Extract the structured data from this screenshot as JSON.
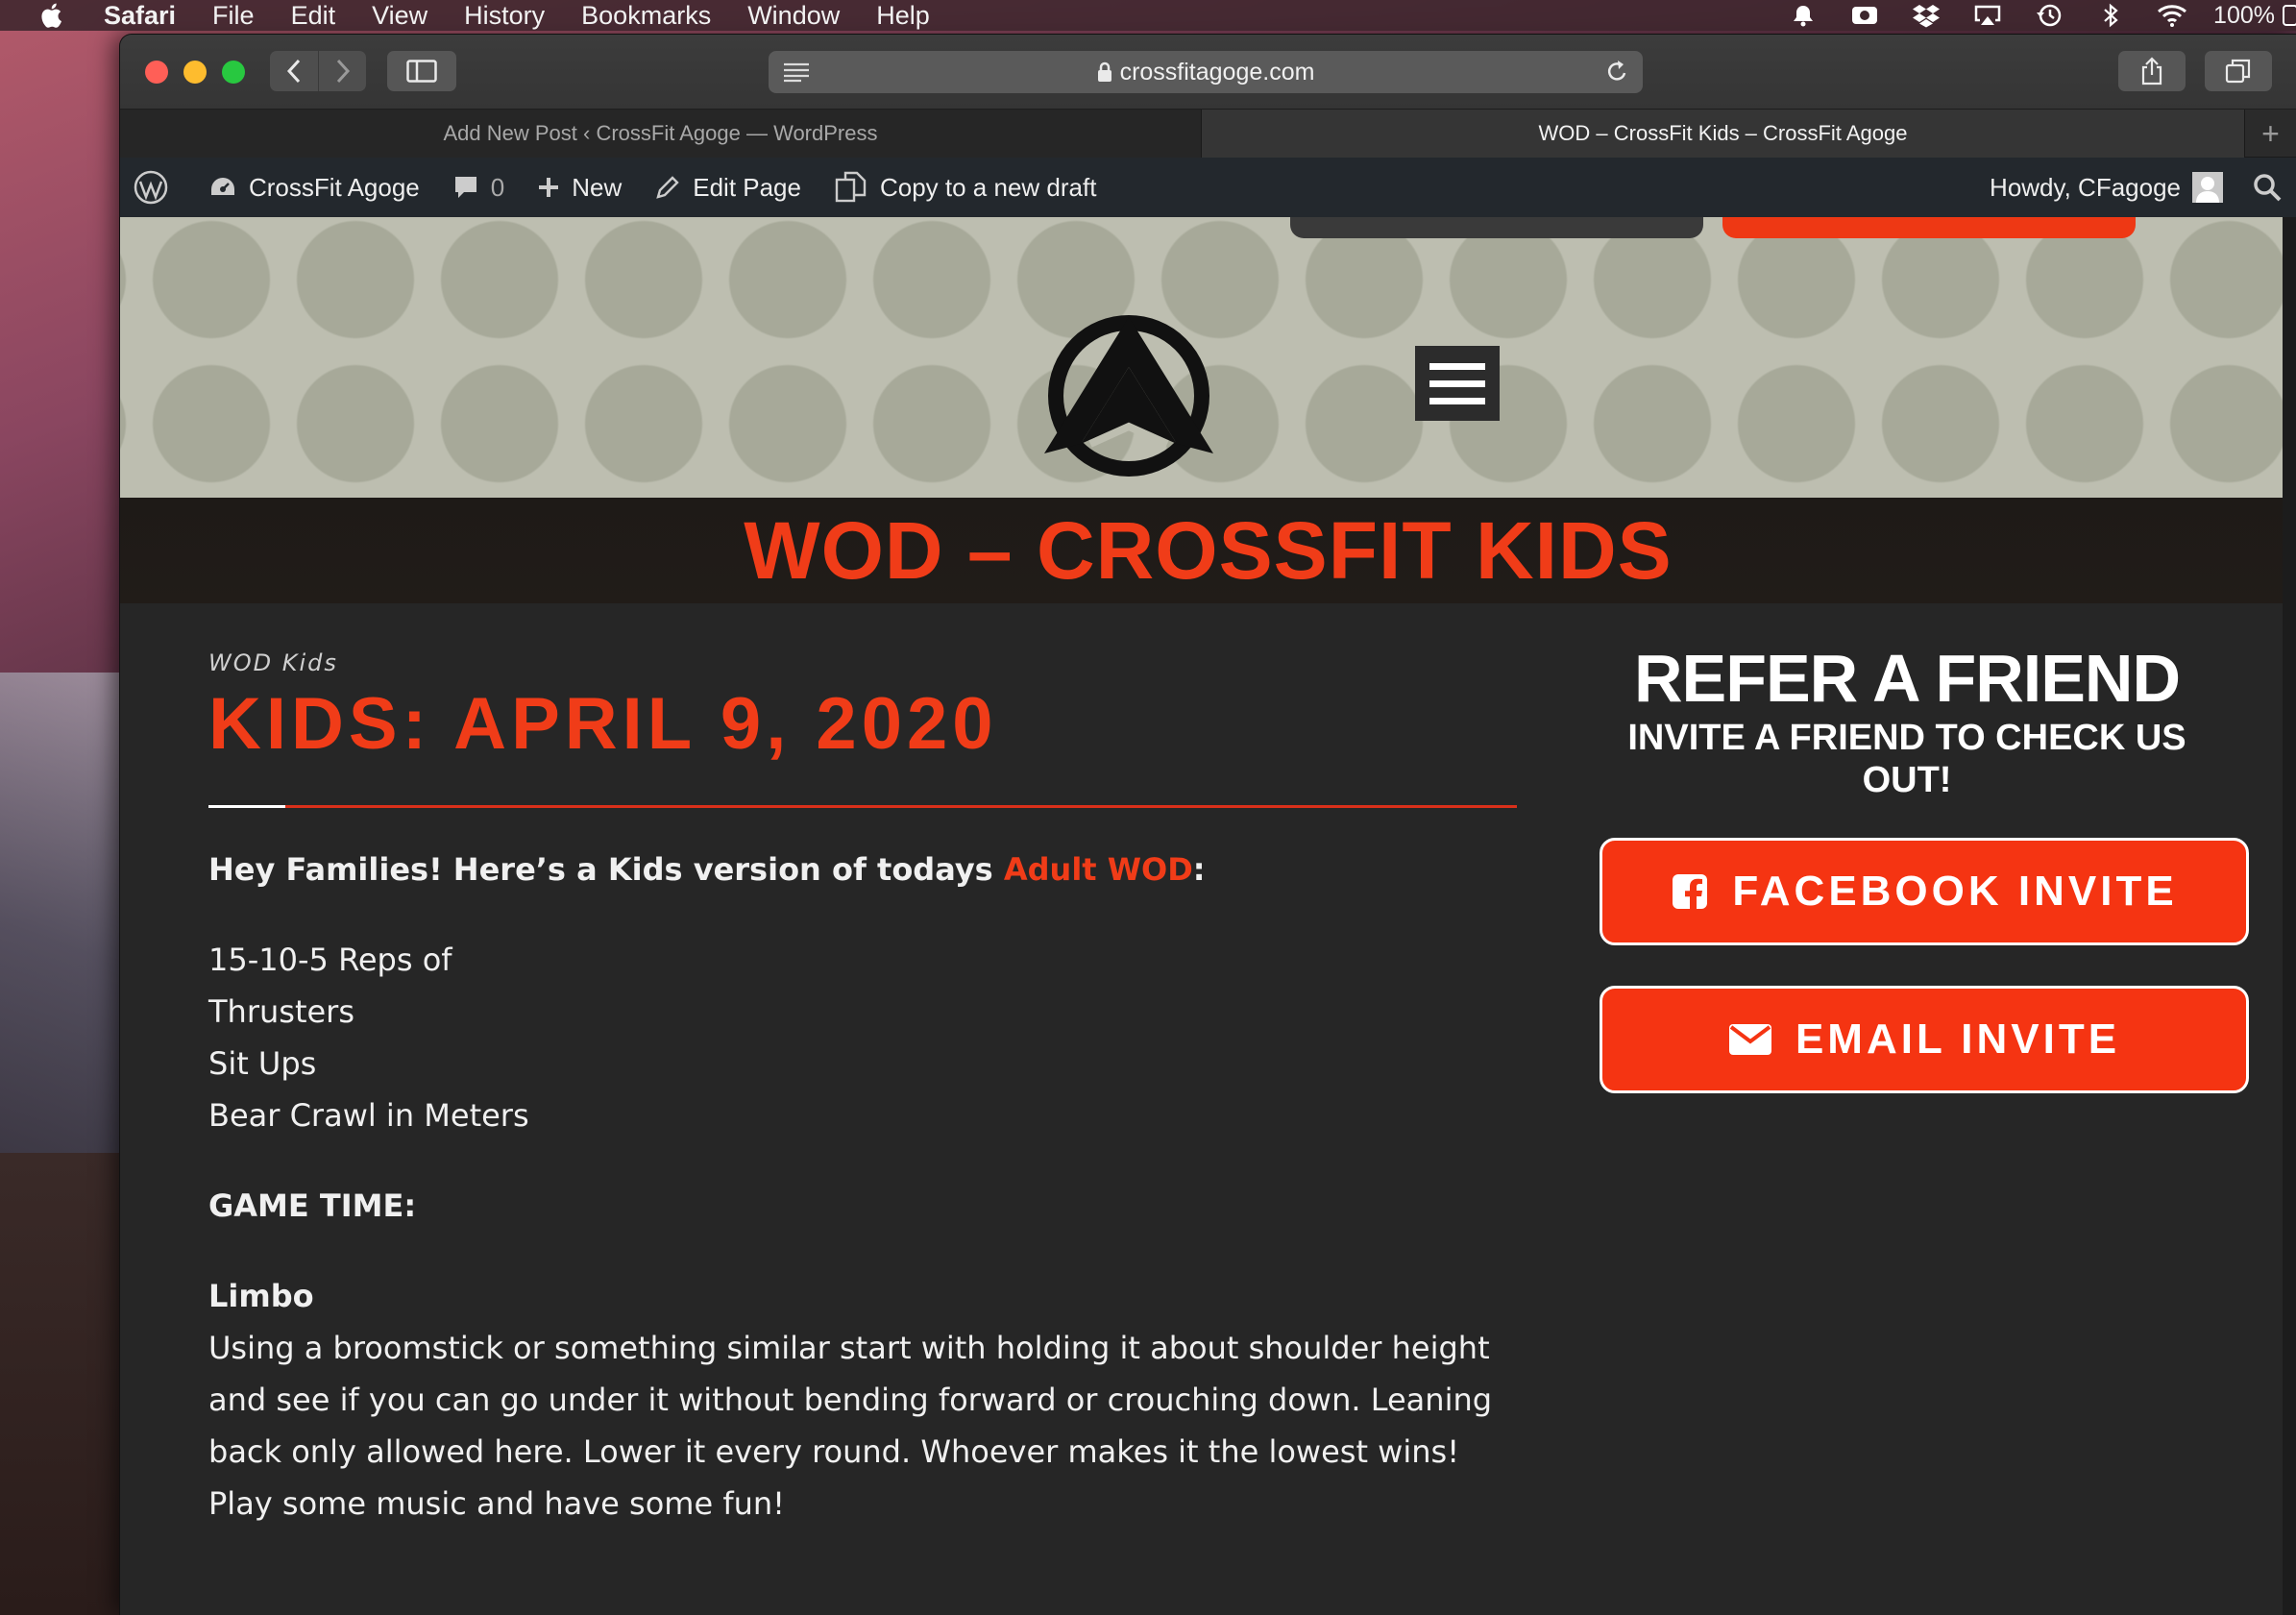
{
  "menubar": {
    "app": "Safari",
    "items": [
      "File",
      "Edit",
      "View",
      "History",
      "Bookmarks",
      "Window",
      "Help"
    ],
    "battery": "100%"
  },
  "browser": {
    "url": "crossfitagoge.com",
    "tabs": [
      {
        "label": "Add New Post ‹ CrossFit Agoge — WordPress",
        "active": false
      },
      {
        "label": "WOD – CrossFit Kids – CrossFit Agoge",
        "active": true
      }
    ],
    "new_tab_symbol": "+"
  },
  "adminbar": {
    "site_name": "CrossFit Agoge",
    "comments": "0",
    "new_label": "New",
    "edit_label": "Edit Page",
    "copy_label": "Copy to a new draft",
    "howdy": "Howdy, CFagoge"
  },
  "site": {
    "page_title": "WOD – CROSSFIT KIDS",
    "post": {
      "category": "WOD Kids",
      "title": "KIDS: APRIL 9, 2020",
      "intro_before": "Hey Families!  Here’s a Kids version of todays ",
      "intro_link": "Adult WOD",
      "intro_after": ":",
      "workout": [
        "15-10-5 Reps of",
        "Thrusters",
        "Sit Ups",
        "Bear Crawl in Meters"
      ],
      "game_time": "GAME TIME:",
      "game_name": "Limbo",
      "game_text": "Using a broomstick or something similar start with holding it about shoulder height and see if you can go under it without bending forward or crouching down.  Leaning back only allowed here.  Lower it every round.  Whoever makes it the lowest wins!  Play some music and have some fun!"
    },
    "sidebar": {
      "refer_title": "REFER A FRIEND",
      "refer_sub": "INVITE A FRIEND TO CHECK US OUT!",
      "facebook_label": "FACEBOOK INVITE",
      "email_label": "EMAIL INVITE"
    }
  },
  "colors": {
    "accent": "#f03c18",
    "admin_bar": "#23282d",
    "header_bg": "#bdbeb0"
  }
}
